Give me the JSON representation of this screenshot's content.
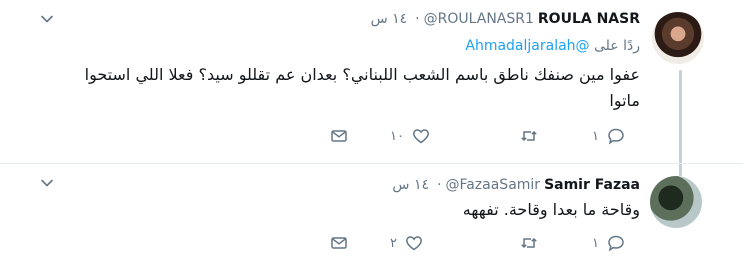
{
  "tweets": [
    {
      "name": "ROULA NASR",
      "handle": "@ROULANASR1",
      "timestamp": "١٤ س",
      "reply_prefix": "ردًا على",
      "reply_handle": "@Ahmadaljaralah",
      "text": "عفوا مين صنفك ناطق باسم الشعب اللبناني؟ بعدان عم تقللو سيد؟ فعلا اللي استحوا ماتوا",
      "reply_count": "١",
      "retweet_count": "",
      "like_count": "١٠"
    },
    {
      "name": "Samir Fazaa",
      "handle": "@FazaaSamir",
      "timestamp": "١٤ س",
      "text": "وقاحة ما بعدا وقاحة. تفههه",
      "reply_count": "١",
      "retweet_count": "",
      "like_count": "٢"
    }
  ],
  "icons": {
    "chevron": "chevron-down-icon",
    "reply": "reply-icon",
    "retweet": "retweet-icon",
    "like": "heart-icon",
    "dm": "envelope-icon"
  },
  "colors": {
    "text": "#14171a",
    "muted": "#657786",
    "link": "#1da1f2",
    "thread_line": "#c4cfd6",
    "divider": "#e6ecf0"
  }
}
